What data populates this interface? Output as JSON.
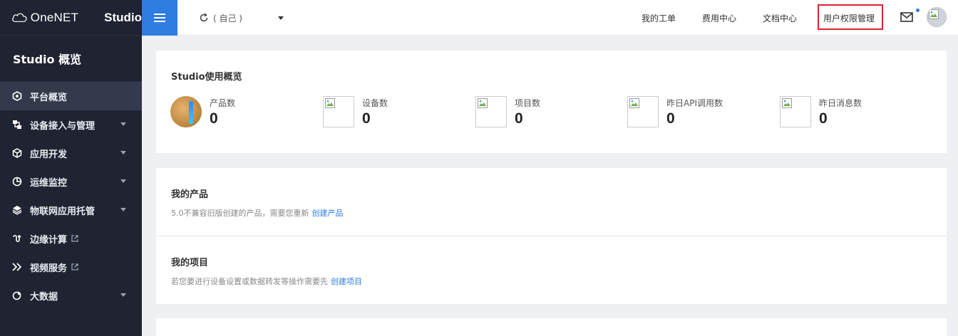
{
  "brand": {
    "logo_text": "OneNET",
    "product": "Studio"
  },
  "sidebar": {
    "title": "Studio 概览",
    "items": [
      {
        "label": "平台概览",
        "icon": "overview-icon",
        "active": true,
        "expandable": false,
        "external": false
      },
      {
        "label": "设备接入与管理",
        "icon": "device-icon",
        "active": false,
        "expandable": true,
        "external": false
      },
      {
        "label": "应用开发",
        "icon": "cube-icon",
        "active": false,
        "expandable": true,
        "external": false
      },
      {
        "label": "运维监控",
        "icon": "pie-chart-icon",
        "active": false,
        "expandable": true,
        "external": false
      },
      {
        "label": "物联网应用托管",
        "icon": "layers-icon",
        "active": false,
        "expandable": true,
        "external": false
      },
      {
        "label": "边缘计算",
        "icon": "edge-icon",
        "active": false,
        "expandable": false,
        "external": true
      },
      {
        "label": "视频服务",
        "icon": "video-icon",
        "active": false,
        "expandable": false,
        "external": true
      },
      {
        "label": "大数据",
        "icon": "bigdata-icon",
        "active": false,
        "expandable": true,
        "external": false
      }
    ]
  },
  "topbar": {
    "scope_selector": "( 自己 )",
    "links": [
      "我的工单",
      "费用中心",
      "文档中心",
      "用户权限管理"
    ],
    "highlighted_link": "用户权限管理"
  },
  "overview": {
    "title": "Studio使用概览",
    "stats": [
      {
        "label": "产品数",
        "value": "0"
      },
      {
        "label": "设备数",
        "value": "0"
      },
      {
        "label": "项目数",
        "value": "0"
      },
      {
        "label": "昨日API调用数",
        "value": "0"
      },
      {
        "label": "昨日消息数",
        "value": "0"
      }
    ]
  },
  "my_products": {
    "title": "我的产品",
    "desc": "5.0不兼容旧版创建的产品，需要您重新",
    "link": "创建产品"
  },
  "my_projects": {
    "title": "我的项目",
    "desc": "若您要进行设备设置或数据转发等操作需要先",
    "link": "创建项目"
  },
  "colors": {
    "accent": "#2f7de1",
    "sidebar_bg": "#1f2332",
    "highlight_box": "#d9262c"
  }
}
